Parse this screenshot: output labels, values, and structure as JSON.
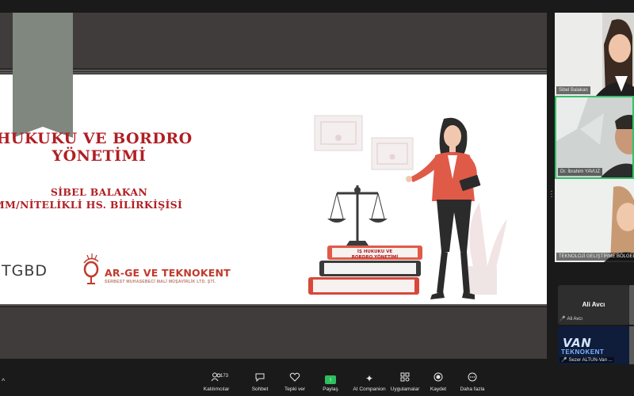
{
  "slide": {
    "title_line1": "HUKUKU VE BORDRO",
    "title_line2": "YÖNETİMİ",
    "presenter": "SİBEL BALAKAN",
    "presenter_title": "MM/NİTELİKLİ HS. BİLİRKİŞİSİ",
    "logo_tgbd": "TGBD",
    "logo_arge": "AR-GE VE TEKNOKENT",
    "logo_arge_sub": "SERBEST MUHASEBECİ MALİ MÜŞAVİRLİK LTD. ŞTİ.",
    "book_label_line1": "İŞ HUKUKU VE",
    "book_label_line2": "BORDRO YÖNETİMİ"
  },
  "participants": [
    {
      "name": "Sibel Balakan",
      "active": false
    },
    {
      "name": "Dr. İbrahim YAVUZ",
      "active": true
    },
    {
      "name": "TEKNOLOJİ GELİŞTİRME BÖLGELERİ",
      "active": false
    }
  ],
  "ali": {
    "display_name": "Ali Avcı",
    "tag": "Ali Avcı"
  },
  "sezer": {
    "tag": "Sezer ALTUN-Van ...",
    "logo_main": "VAN",
    "logo_sub": "TEKNOKENT"
  },
  "toolbar": {
    "participants_label": "Katılımcılar",
    "participants_count": "173",
    "chat_label": "Sohbet",
    "react_label": "Tepki ver",
    "share_label": "Paylaş",
    "ai_label": "AI Companion",
    "apps_label": "Uygulamalar",
    "record_label": "Kaydet",
    "more_label": "Daha fazla"
  },
  "colors": {
    "accent_red": "#b01f24",
    "active_border": "#35c26a",
    "share_green": "#2dbf5e"
  }
}
